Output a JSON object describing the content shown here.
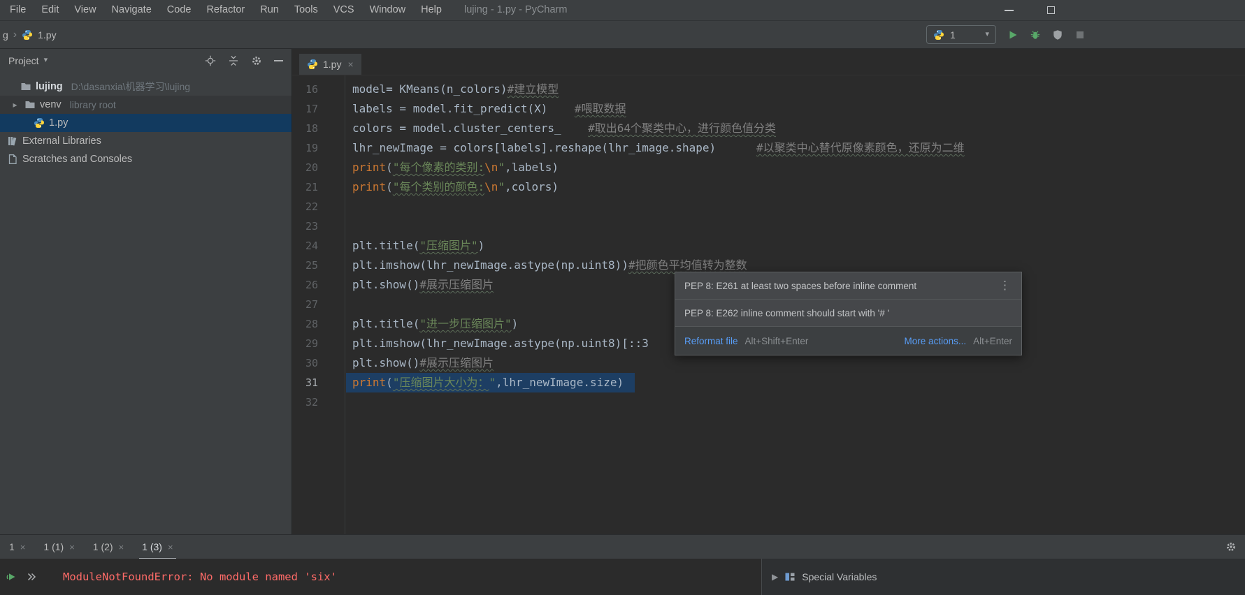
{
  "window": {
    "title": "lujing - 1.py - PyCharm",
    "menus": [
      "File",
      "Edit",
      "View",
      "Navigate",
      "Code",
      "Refactor",
      "Run",
      "Tools",
      "VCS",
      "Window",
      "Help"
    ]
  },
  "toolbar": {
    "breadcrumb_tail": "g",
    "breadcrumb_file": "1.py",
    "run_config_label": "1"
  },
  "project_panel": {
    "title": "Project",
    "items": [
      {
        "label": "lujing",
        "detail": "D:\\dasanxia\\机器学习\\lujing",
        "icon": "folder",
        "level": 1,
        "bold": true
      },
      {
        "label": "venv",
        "detail": "library root",
        "icon": "folder",
        "level": 1,
        "arrow": true,
        "dim": true
      },
      {
        "label": "1.py",
        "icon": "python",
        "level": 2,
        "selected": true
      },
      {
        "label": "External Libraries",
        "icon": "library",
        "level": 0
      },
      {
        "label": "Scratches and Consoles",
        "icon": "scratches",
        "level": 0
      }
    ]
  },
  "editor": {
    "tab_label": "1.py",
    "lines": [
      {
        "num": 16,
        "tokens": [
          {
            "c": "d",
            "t": "model= KMeans(n_colors)"
          },
          {
            "c": "comU",
            "t": "#建立模型"
          }
        ]
      },
      {
        "num": 17,
        "tokens": [
          {
            "c": "d",
            "t": "labels = model.fit_predict(X)    "
          },
          {
            "c": "comU",
            "t": "#喂取数据"
          }
        ]
      },
      {
        "num": 18,
        "tokens": [
          {
            "c": "d",
            "t": "colors = model.cluster_centers_    "
          },
          {
            "c": "comU",
            "t": "#取出64个聚类中心，进行颜色值分类"
          }
        ]
      },
      {
        "num": 19,
        "tokens": [
          {
            "c": "d",
            "t": "lhr_newImage = colors[labels].reshape(lhr_image.shape)      "
          },
          {
            "c": "comU",
            "t": "#以聚类中心替代原像素颜色，还原为二维"
          }
        ]
      },
      {
        "num": 20,
        "tokens": [
          {
            "c": "kw",
            "t": "print"
          },
          {
            "c": "d",
            "t": "("
          },
          {
            "c": "strU",
            "t": "\"每个像素的类别:"
          },
          {
            "c": "esc",
            "t": "\\n"
          },
          {
            "c": "str",
            "t": "\""
          },
          {
            "c": "d",
            "t": ",labels)"
          }
        ]
      },
      {
        "num": 21,
        "tokens": [
          {
            "c": "kw",
            "t": "print"
          },
          {
            "c": "d",
            "t": "("
          },
          {
            "c": "strU",
            "t": "\"每个类别的颜色:"
          },
          {
            "c": "esc",
            "t": "\\n"
          },
          {
            "c": "str",
            "t": "\""
          },
          {
            "c": "d",
            "t": ",colors)"
          }
        ]
      },
      {
        "num": 22,
        "tokens": []
      },
      {
        "num": 23,
        "tokens": []
      },
      {
        "num": 24,
        "tokens": [
          {
            "c": "d",
            "t": "plt.title("
          },
          {
            "c": "strU",
            "t": "\"压缩图片\""
          },
          {
            "c": "d",
            "t": ")"
          }
        ]
      },
      {
        "num": 25,
        "tokens": [
          {
            "c": "d",
            "t": "plt.imshow(lhr_newImage.astype(np.uint8))"
          },
          {
            "c": "comU",
            "t": "#把颜色平均值转为整数"
          }
        ]
      },
      {
        "num": 26,
        "tokens": [
          {
            "c": "d",
            "t": "plt.show()"
          },
          {
            "c": "comU",
            "t": "#展示压缩图片"
          }
        ]
      },
      {
        "num": 27,
        "tokens": []
      },
      {
        "num": 28,
        "tokens": [
          {
            "c": "d",
            "t": "plt.title("
          },
          {
            "c": "strU",
            "t": "\"进一步压缩图片\""
          },
          {
            "c": "d",
            "t": ")"
          }
        ]
      },
      {
        "num": 29,
        "tokens": [
          {
            "c": "d",
            "t": "plt.imshow(lhr_newImage.astype(np.uint8)[::3"
          }
        ]
      },
      {
        "num": 30,
        "tokens": [
          {
            "c": "d",
            "t": "plt.show()"
          },
          {
            "c": "comU",
            "t": "#展示压缩图片"
          }
        ]
      },
      {
        "num": 31,
        "selected": true,
        "tokens": [
          {
            "c": "kw",
            "t": "print"
          },
          {
            "c": "d",
            "t": "("
          },
          {
            "c": "strU",
            "t": "\"压缩图片大小为："
          },
          {
            "c": "str",
            "t": "\""
          },
          {
            "c": "d",
            "t": ",lhr_newImage.size)"
          }
        ]
      },
      {
        "num": 32,
        "tokens": []
      }
    ]
  },
  "popup": {
    "items": [
      {
        "text": "PEP 8: E261 at least two spaces before inline comment"
      },
      {
        "text": "PEP 8: E262 inline comment should start with '# '"
      }
    ],
    "reformat_label": "Reformat file",
    "reformat_shortcut": "Alt+Shift+Enter",
    "more_label": "More actions...",
    "more_shortcut": "Alt+Enter"
  },
  "run_panel": {
    "tabs": [
      {
        "label": "1"
      },
      {
        "label": "1 (1)"
      },
      {
        "label": "1 (2)"
      },
      {
        "label": "1 (3)"
      }
    ],
    "active_tab": 3,
    "console_error": "ModuleNotFoundError: No module named 'six'"
  },
  "variables_panel": {
    "title": "Special Variables"
  },
  "colors": {
    "accent_link": "#589df6",
    "error_text": "#ff6b68",
    "selection": "#1d3e63",
    "run_green": "#59a869"
  }
}
